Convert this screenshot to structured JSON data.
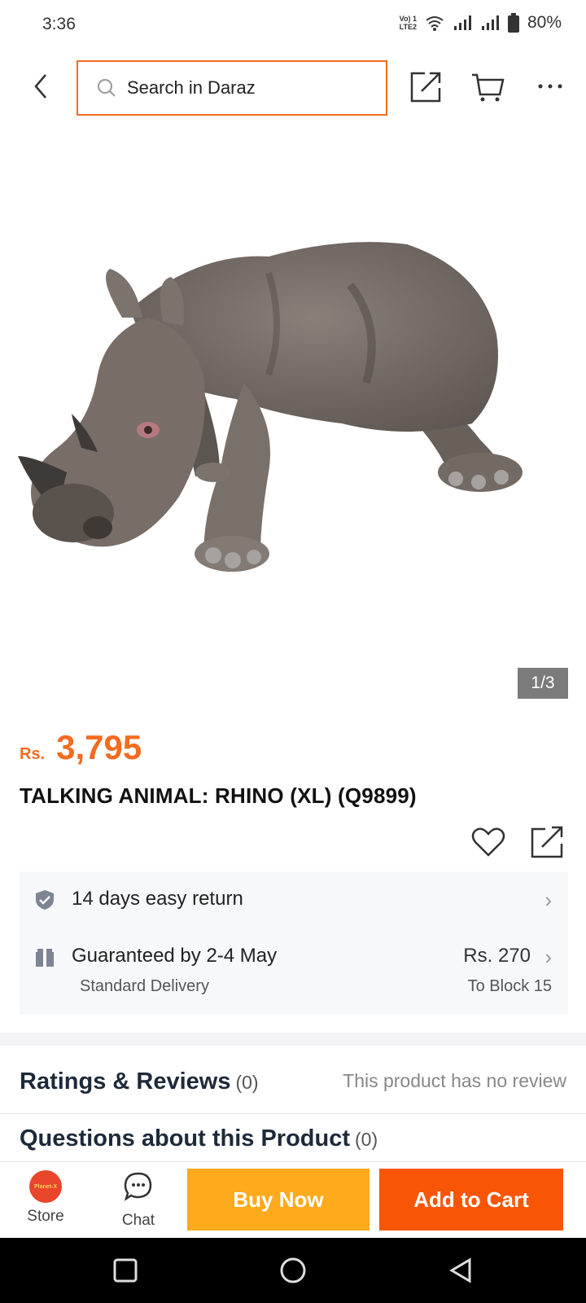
{
  "status_bar": {
    "time": "3:36",
    "network_tag_top": "Vo) 1",
    "network_tag_bottom": "LTE2",
    "battery": "80%"
  },
  "header": {
    "search_placeholder": "Search in Daraz",
    "icons": [
      "back-arrow-icon",
      "search-icon",
      "share-icon",
      "cart-icon",
      "more-icon"
    ]
  },
  "gallery": {
    "counter": "1/3"
  },
  "product": {
    "currency": "Rs.",
    "price": "3,795",
    "title": "TALKING ANIMAL: RHINO (XL) (Q9899)"
  },
  "delivery": {
    "return_text": "14 days easy return",
    "guarantee_text": "Guaranteed by 2-4 May",
    "guarantee_sub": "Standard Delivery",
    "fee": "Rs. 270",
    "destination": "To Block 15"
  },
  "ratings": {
    "title": "Ratings & Reviews",
    "count": "(0)",
    "empty_text": "This product has no review"
  },
  "questions": {
    "title": "Questions about this Product",
    "count": "(0)"
  },
  "bottom_bar": {
    "store_label": "Store",
    "store_logo_text": "Planet-X",
    "chat_label": "Chat",
    "buy_now": "Buy Now",
    "add_to_cart": "Add to Cart"
  },
  "colors": {
    "accent": "#f36c21",
    "buy_now": "#fdaa1c",
    "add_to_cart": "#f85606"
  }
}
